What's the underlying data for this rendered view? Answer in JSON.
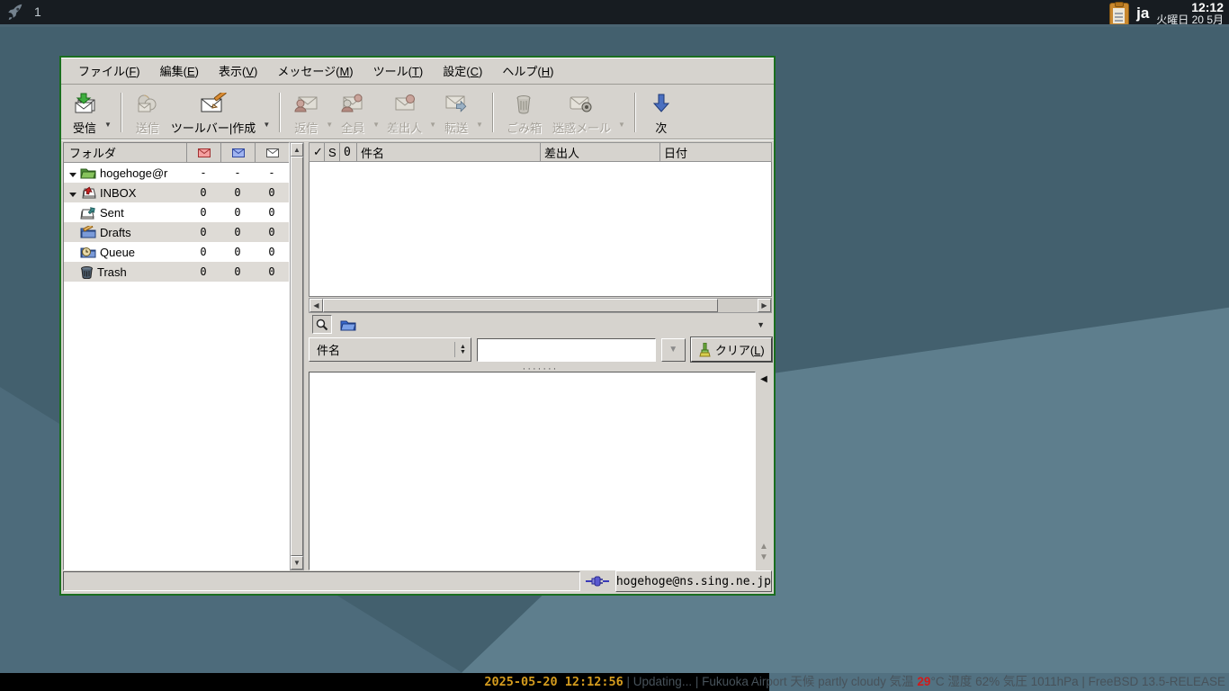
{
  "taskbar_top": {
    "workspace": "1",
    "lang": "ja",
    "time": "12:12",
    "date": "火曜日 20 5月"
  },
  "menu": {
    "items": [
      {
        "pre": "ファイル(",
        "key": "F",
        "post": ")"
      },
      {
        "pre": "編集(",
        "key": "E",
        "post": ")"
      },
      {
        "pre": "表示(",
        "key": "V",
        "post": ")"
      },
      {
        "pre": "メッセージ(",
        "key": "M",
        "post": ")"
      },
      {
        "pre": "ツール(",
        "key": "T",
        "post": ")"
      },
      {
        "pre": "設定(",
        "key": "C",
        "post": ")"
      },
      {
        "pre": "ヘルプ(",
        "key": "H",
        "post": ")"
      }
    ]
  },
  "toolbar": {
    "buttons": [
      {
        "label": "受信",
        "enabled": true,
        "dropdown": true
      },
      {
        "label": "送信",
        "enabled": false,
        "dropdown": false
      },
      {
        "label": "ツールバー|作成",
        "enabled": true,
        "dropdown": true
      },
      {
        "label": "返信",
        "enabled": false,
        "dropdown": true
      },
      {
        "label": "全員",
        "enabled": false,
        "dropdown": true
      },
      {
        "label": "差出人",
        "enabled": false,
        "dropdown": true
      },
      {
        "label": "転送",
        "enabled": false,
        "dropdown": true
      },
      {
        "label": "ごみ箱",
        "enabled": false,
        "dropdown": false
      },
      {
        "label": "迷惑メール",
        "enabled": false,
        "dropdown": true
      },
      {
        "label": "次",
        "enabled": true,
        "dropdown": false
      }
    ]
  },
  "folder_pane": {
    "header": "フォルダ",
    "count_columns": [
      "unread-envelope-icon",
      "new-envelope-icon",
      "total-envelope-icon"
    ],
    "rows": [
      {
        "name": "hogehoge@r",
        "unread": "-",
        "new": "-",
        "total": "-"
      },
      {
        "name": "INBOX",
        "unread": "0",
        "new": "0",
        "total": "0"
      },
      {
        "name": "Sent",
        "unread": "0",
        "new": "0",
        "total": "0"
      },
      {
        "name": "Drafts",
        "unread": "0",
        "new": "0",
        "total": "0"
      },
      {
        "name": "Queue",
        "unread": "0",
        "new": "0",
        "total": "0"
      },
      {
        "name": "Trash",
        "unread": "0",
        "new": "0",
        "total": "0"
      }
    ]
  },
  "message_list": {
    "columns": {
      "mark": "✓",
      "status": "S",
      "attach": "0",
      "subject": "件名",
      "from": "差出人",
      "date": "日付"
    }
  },
  "quick_filter": {
    "target": "件名",
    "input_value": "",
    "clear": {
      "pre": "クリア(",
      "key": "L",
      "post": ")"
    }
  },
  "statusbar": {
    "account": "hogehoge@ns.sing.ne.jp"
  },
  "taskbar_bottom": {
    "datetime": "2025-05-20 12:12:56",
    "mid": " | Updating... | Fukuoka Airport 天候 partly cloudy 気温 ",
    "temp": "29",
    "rest": "°C 湿度 62% 気圧 1011hPa | FreeBSD 13.5-RELEASE"
  },
  "colors": {
    "window_border": "#1a6e1f",
    "datetime_orange": "#d59c1e",
    "temp_red": "#d11a1a",
    "desktop_base": "#5e7e8d",
    "desktop_dark": "#43606e",
    "panel_gray": "#d6d3ce"
  }
}
